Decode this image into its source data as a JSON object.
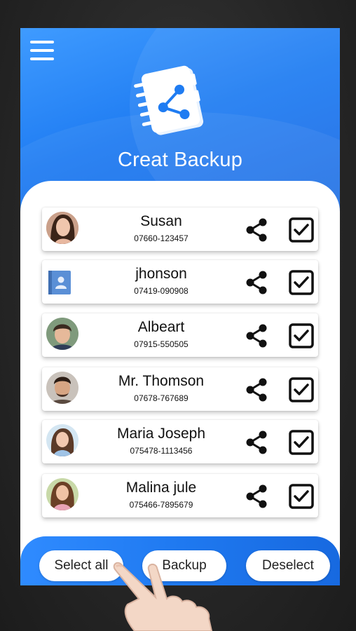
{
  "header": {
    "title": "Creat Backup",
    "icons": {
      "menu": "hamburger-menu-icon",
      "logo": "contact-book-share-icon"
    }
  },
  "contacts": [
    {
      "name": "Susan",
      "phone": "07660-123457",
      "avatar": "photo"
    },
    {
      "name": "jhonson",
      "phone": "07419-090908",
      "avatar": "contact-book"
    },
    {
      "name": "Albeart",
      "phone": "07915-550505",
      "avatar": "photo"
    },
    {
      "name": "Mr. Thomson",
      "phone": "07678-767689",
      "avatar": "photo"
    },
    {
      "name": "Maria Joseph",
      "phone": "075478-1113456",
      "avatar": "photo"
    },
    {
      "name": "Malina jule",
      "phone": "075466-7895679",
      "avatar": "photo"
    }
  ],
  "actions": {
    "select_all": "Select all",
    "backup": "Backup",
    "deselect": "Deselect"
  },
  "colors": {
    "primary": "#1f7cf2",
    "primary_light": "#3f9bff",
    "text": "#111111",
    "card": "#ffffff"
  }
}
